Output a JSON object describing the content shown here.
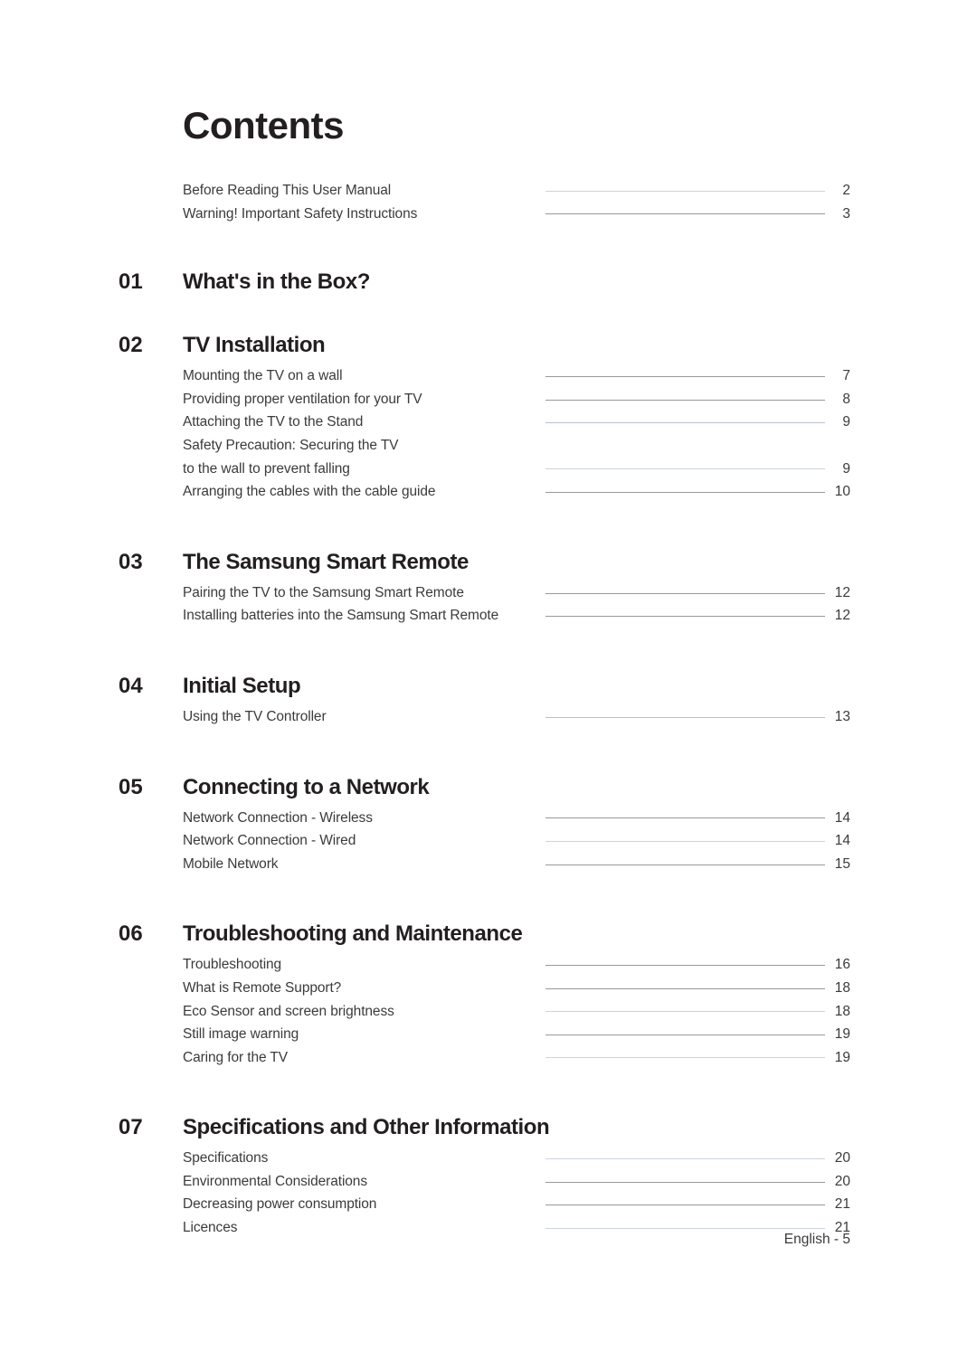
{
  "page": {
    "title": "Contents",
    "footer": "English - 5"
  },
  "preface": [
    {
      "label": "Before Reading This User Manual",
      "page": "2",
      "leader": "faintest"
    },
    {
      "label": "Warning! Important Safety Instructions",
      "page": "3",
      "leader": "normal"
    }
  ],
  "sections": [
    {
      "number": "01",
      "title": "What's in the Box?",
      "entries": []
    },
    {
      "number": "02",
      "title": "TV Installation",
      "entries": [
        {
          "label": "Mounting the TV on a wall",
          "page": "7",
          "leader": "normal"
        },
        {
          "label": "Providing proper ventilation for your TV",
          "page": "8",
          "leader": "normal"
        },
        {
          "label": "Attaching the TV to the Stand",
          "page": "9",
          "leader": "faint"
        },
        {
          "label": "Safety Precaution: Securing the TV",
          "page": "",
          "leader": "hidden"
        },
        {
          "label": "to the wall to prevent falling",
          "page": "9",
          "leader": "faintest"
        },
        {
          "label": "Arranging the cables with the cable guide",
          "page": "10",
          "leader": "normal"
        }
      ]
    },
    {
      "number": "03",
      "title": "The Samsung Smart Remote",
      "entries": [
        {
          "label": "Pairing the TV to the Samsung Smart Remote",
          "page": "12",
          "leader": "normal"
        },
        {
          "label": "Installing batteries into the Samsung Smart Remote",
          "page": "12",
          "leader": "normal"
        }
      ]
    },
    {
      "number": "04",
      "title": "Initial Setup",
      "entries": [
        {
          "label": "Using the TV Controller",
          "page": "13",
          "leader": "faint"
        }
      ]
    },
    {
      "number": "05",
      "title": "Connecting to a Network",
      "entries": [
        {
          "label": "Network Connection - Wireless",
          "page": "14",
          "leader": "normal"
        },
        {
          "label": "Network Connection - Wired",
          "page": "14",
          "leader": "faintest"
        },
        {
          "label": "Mobile Network",
          "page": "15",
          "leader": "normal"
        }
      ]
    },
    {
      "number": "06",
      "title": "Troubleshooting and Maintenance",
      "entries": [
        {
          "label": "Troubleshooting",
          "page": "16",
          "leader": "normal"
        },
        {
          "label": "What is Remote Support?",
          "page": "18",
          "leader": "normal"
        },
        {
          "label": "Eco Sensor and screen brightness",
          "page": "18",
          "leader": "faintest"
        },
        {
          "label": "Still image warning",
          "page": "19",
          "leader": "normal"
        },
        {
          "label": "Caring for the TV",
          "page": "19",
          "leader": "faintest"
        }
      ]
    },
    {
      "number": "07",
      "title": "Specifications and Other Information",
      "entries": [
        {
          "label": "Specifications",
          "page": "20",
          "leader": "faintest"
        },
        {
          "label": "Environmental Considerations",
          "page": "20",
          "leader": "normal"
        },
        {
          "label": "Decreasing power consumption",
          "page": "21",
          "leader": "normal"
        },
        {
          "label": "Licences",
          "page": "21",
          "leader": "faintest"
        }
      ]
    }
  ]
}
